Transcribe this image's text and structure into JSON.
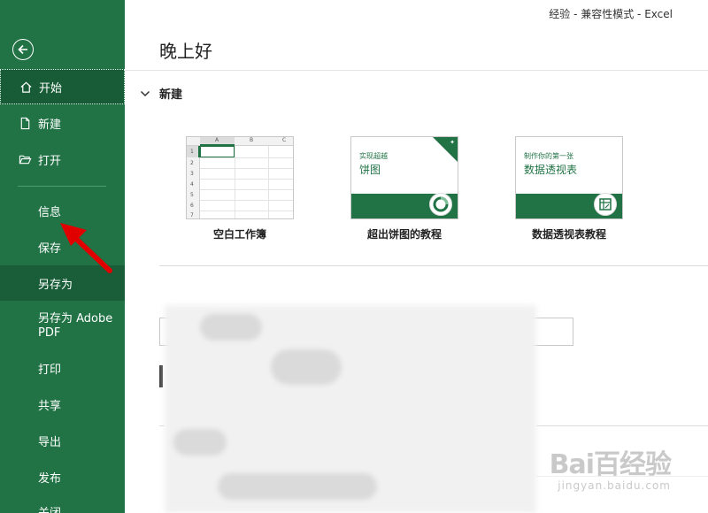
{
  "window": {
    "title": "经验  -  兼容性模式  -  Excel"
  },
  "sidebar": {
    "back_icon": "back-arrow-circle-icon",
    "items": [
      {
        "label": "开始",
        "icon": "home-icon"
      },
      {
        "label": "新建",
        "icon": "new-document-icon"
      },
      {
        "label": "打开",
        "icon": "folder-open-icon"
      },
      {
        "label": "信息"
      },
      {
        "label": "保存"
      },
      {
        "label": "另存为"
      },
      {
        "label": "另存为 Adobe PDF"
      },
      {
        "label": "打印"
      },
      {
        "label": "共享"
      },
      {
        "label": "导出"
      },
      {
        "label": "发布"
      },
      {
        "label": "关闭"
      }
    ],
    "active_index": 0,
    "hover_index": 5
  },
  "main": {
    "greeting": "晚上好",
    "new_section": {
      "title": "新建",
      "templates": [
        {
          "caption": "空白工作簿",
          "columns": [
            "A",
            "B",
            "C"
          ],
          "rows": [
            "1",
            "2",
            "3",
            "4",
            "5",
            "6",
            "7"
          ]
        },
        {
          "caption": "超出饼图的教程",
          "line1": "实现超越",
          "line2": "饼图"
        },
        {
          "caption": "数据透视表教程",
          "line1": "制作你的第一张",
          "line2": "数据透视表"
        }
      ]
    }
  },
  "colors": {
    "excel_green": "#217346",
    "excel_green_dark": "#185c37",
    "annotation_red": "#e00000"
  },
  "watermark": {
    "brand": "Bai百经验",
    "url": "jingyan.baidu.com"
  }
}
